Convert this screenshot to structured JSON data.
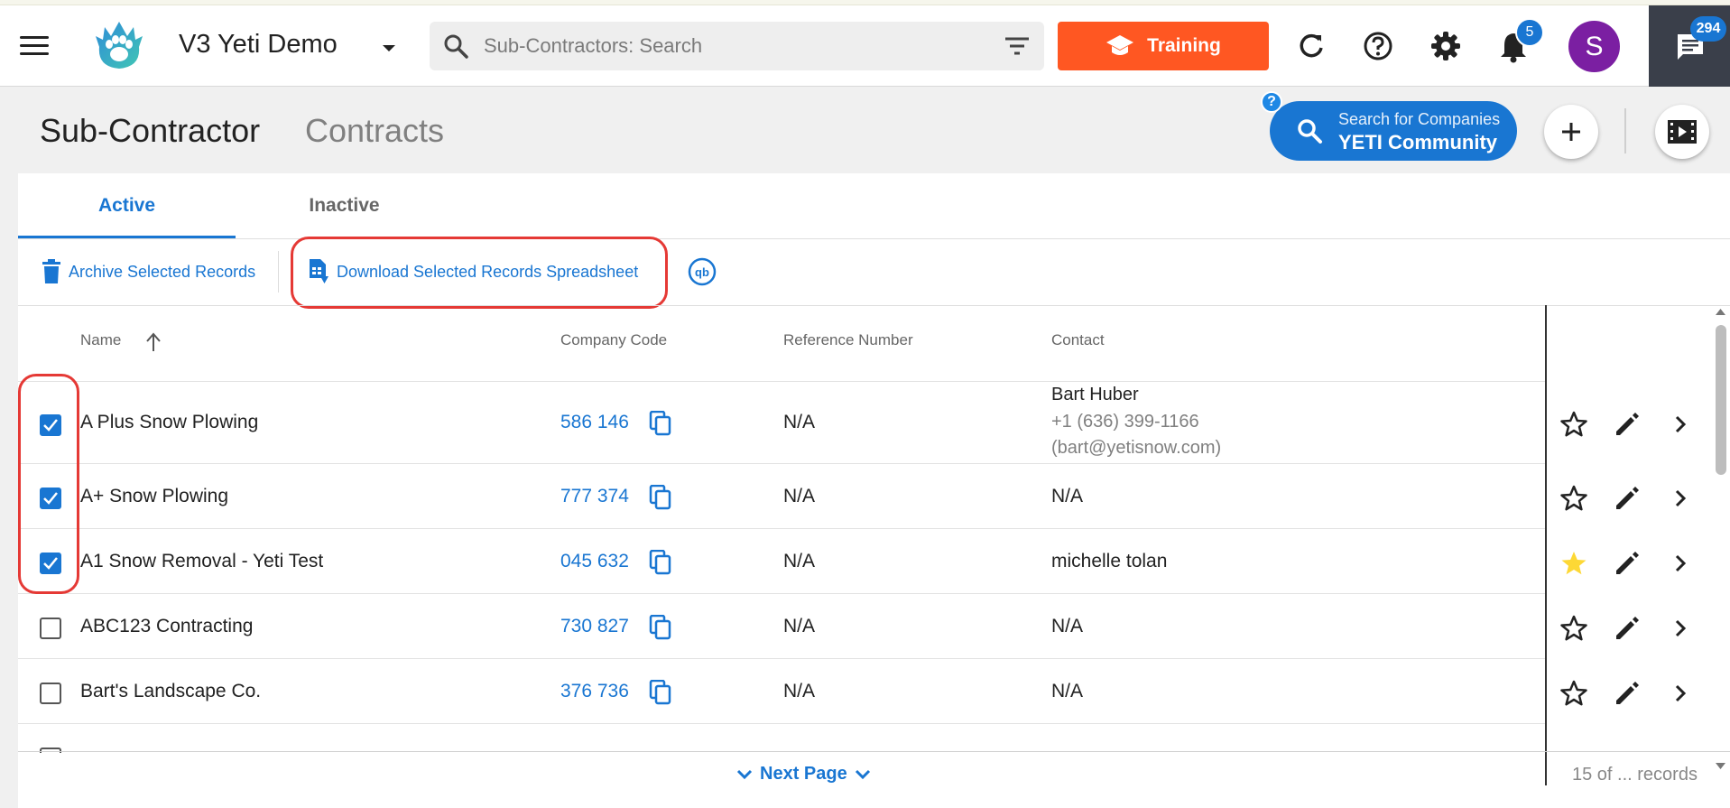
{
  "app": {
    "title": "V3 Yeti Demo"
  },
  "search": {
    "placeholder": "Sub-Contractors: Search"
  },
  "header": {
    "training_label": "Training",
    "notifications_count": "5",
    "avatar_initial": "S",
    "chat_count": "294"
  },
  "page": {
    "title_primary": "Sub-Contractor",
    "title_secondary": "Contracts",
    "community_line1": "Search for Companies",
    "community_line2": "YETI Community",
    "help_mark": "?"
  },
  "tabs": [
    {
      "label": "Active",
      "active": true
    },
    {
      "label": "Inactive",
      "active": false
    }
  ],
  "actions": {
    "archive_label": "Archive Selected Records",
    "download_label": "Download Selected Records Spreadsheet",
    "qb_label": "qb"
  },
  "table": {
    "columns": [
      "Name",
      "Company Code",
      "Reference Number",
      "Contact"
    ],
    "rows": [
      {
        "checked": true,
        "name": "A Plus Snow Plowing",
        "code": "586 146",
        "ref": "N/A",
        "contact": "Bart Huber",
        "phone": "+1 (636) 399-1166",
        "email": "(bart@yetisnow.com)",
        "starred": false
      },
      {
        "checked": true,
        "name": "A+ Snow Plowing",
        "code": "777 374",
        "ref": "N/A",
        "contact": "N/A",
        "starred": false
      },
      {
        "checked": true,
        "name": "A1 Snow Removal - Yeti Test",
        "code": "045 632",
        "ref": "N/A",
        "contact": "michelle tolan",
        "starred": true
      },
      {
        "checked": false,
        "name": "ABC123 Contracting",
        "code": "730 827",
        "ref": "N/A",
        "contact": "N/A",
        "starred": false
      },
      {
        "checked": false,
        "name": "Bart's Landscape Co.",
        "code": "376 736",
        "ref": "N/A",
        "contact": "N/A",
        "starred": false
      }
    ]
  },
  "footer": {
    "next_page_label": "Next Page",
    "records_label": "15 of ... records"
  },
  "colors": {
    "accent": "#1976d2",
    "training": "#ff5722",
    "avatar": "#7b1fa2",
    "star_filled": "#fdd835",
    "highlight_box": "#e53935"
  }
}
